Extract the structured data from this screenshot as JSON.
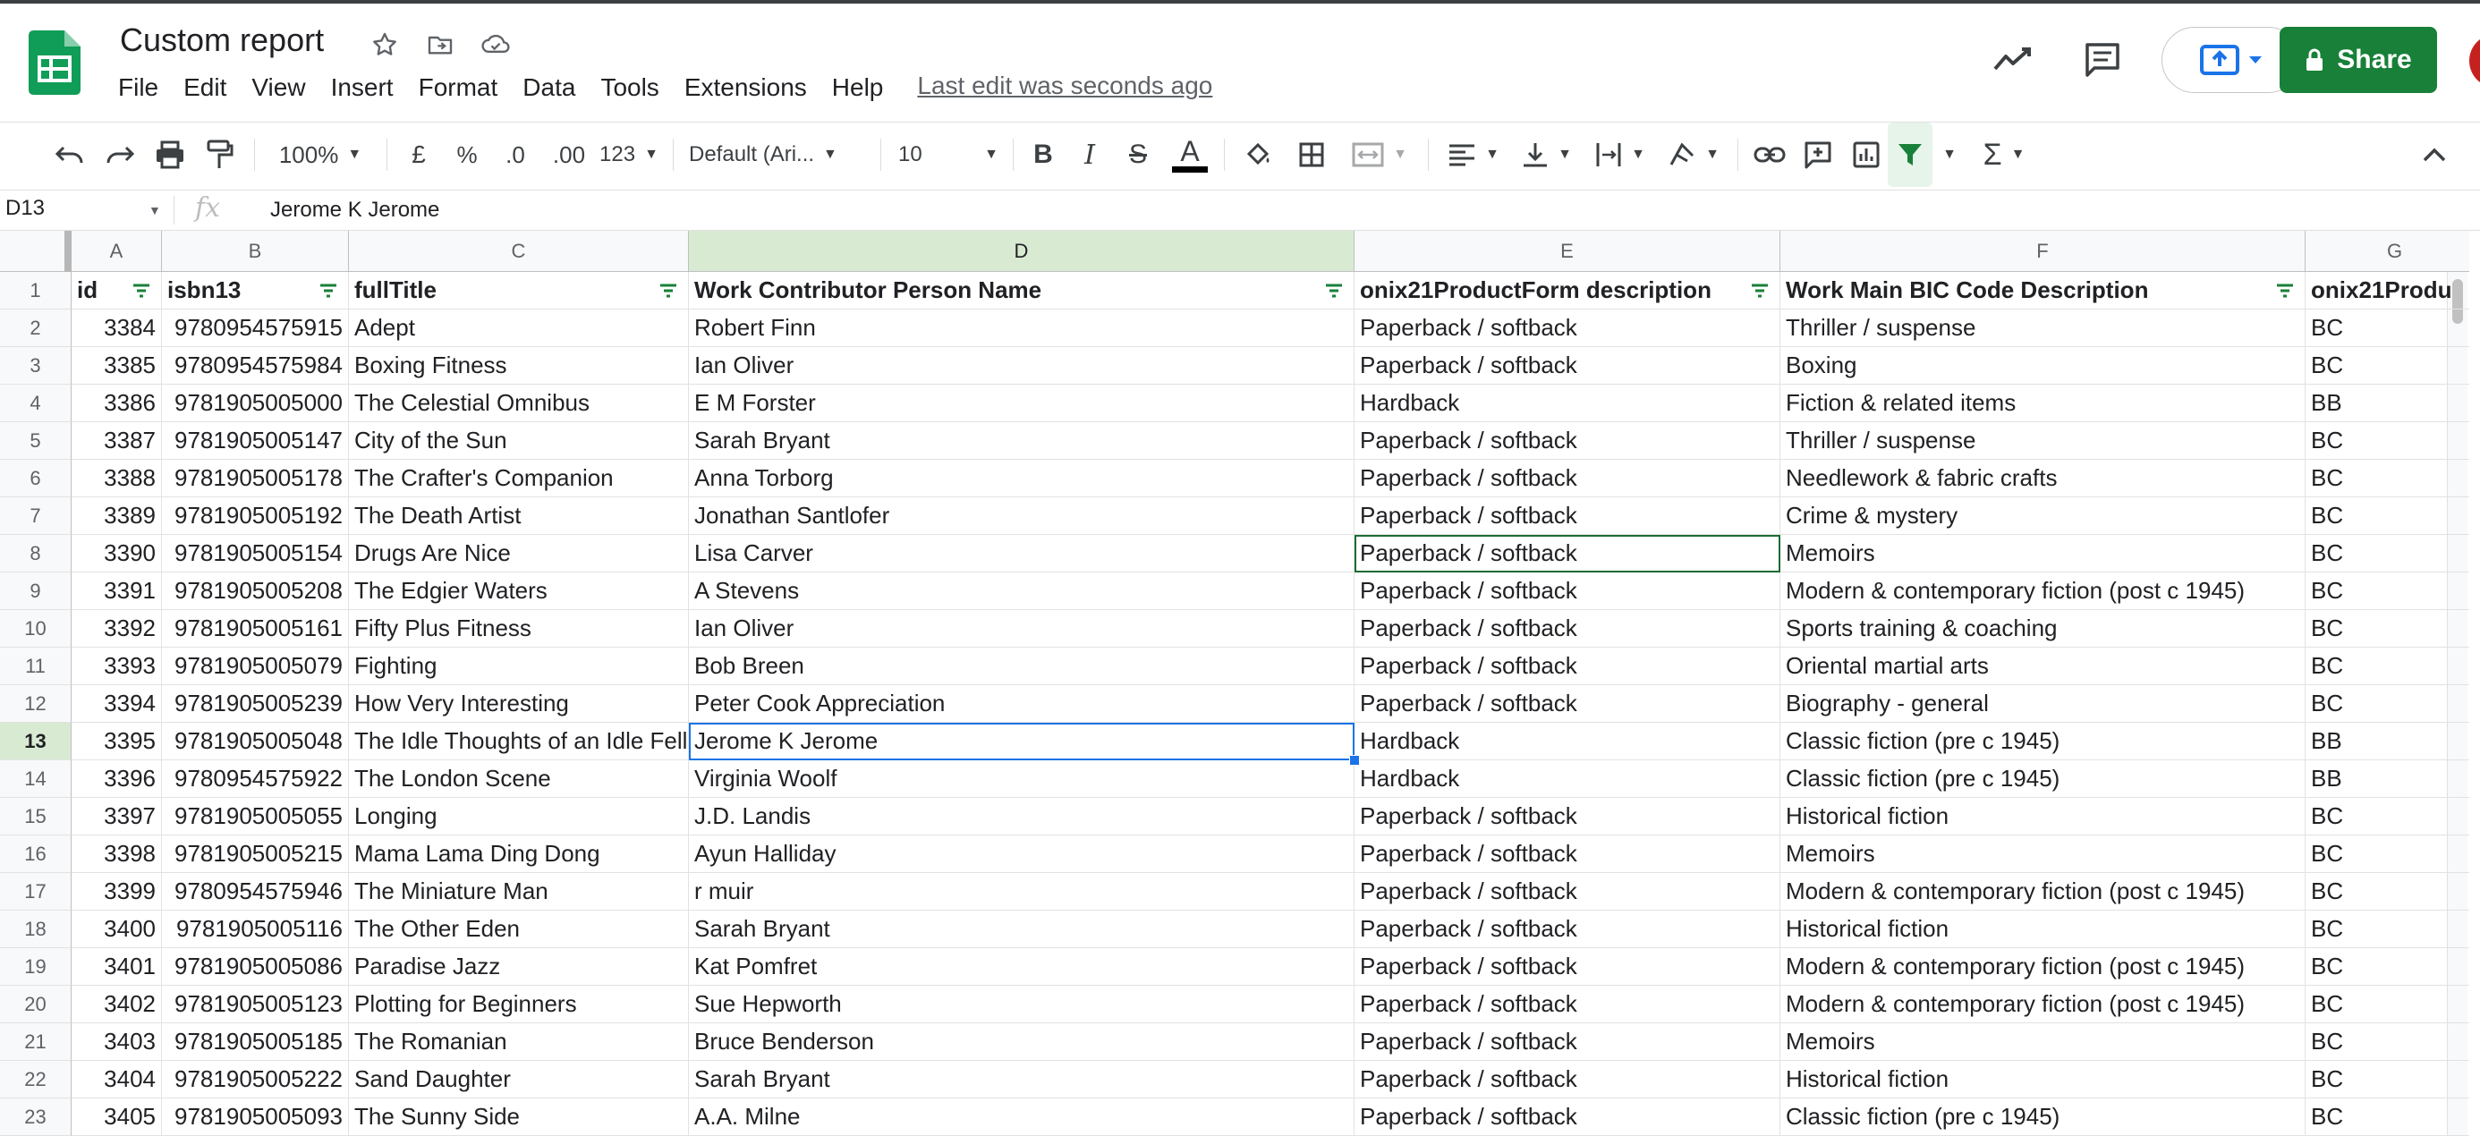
{
  "app": {
    "title": "Custom report",
    "menu": [
      "File",
      "Edit",
      "View",
      "Insert",
      "Format",
      "Data",
      "Tools",
      "Extensions",
      "Help"
    ],
    "last_edit": "Last edit was seconds ago",
    "share_label": "Share",
    "brand_color": "#188038"
  },
  "toolbar": {
    "zoom": "100%",
    "currency": "£",
    "percent": "%",
    "dec_decrease": ".0",
    "dec_increase": ".00",
    "more_formats": "123",
    "font_family": "Default (Ari...",
    "font_size": "10",
    "bold": "B",
    "italic": "I",
    "strike": "S",
    "text_color": "A",
    "sum": "Σ"
  },
  "formula_bar": {
    "cell_ref": "D13",
    "fx": "fx",
    "value": "Jerome K Jerome"
  },
  "grid": {
    "columns": [
      "A",
      "B",
      "C",
      "D",
      "E",
      "F",
      "G"
    ],
    "row_numbers": [
      "1",
      "2",
      "3",
      "4",
      "5",
      "6",
      "7",
      "8",
      "9",
      "10",
      "11",
      "12",
      "13",
      "14",
      "15",
      "16",
      "17",
      "18",
      "19",
      "20",
      "21",
      "22",
      "23"
    ],
    "headers": [
      "id",
      "isbn13",
      "fullTitle",
      "Work Contributor Person Name",
      "onix21ProductForm description",
      "Work Main BIC Code Description",
      "onix21Produ"
    ],
    "rows": [
      [
        "3384",
        "9780954575915",
        "Adept",
        "Robert Finn",
        "Paperback / softback",
        "Thriller / suspense",
        "BC"
      ],
      [
        "3385",
        "9780954575984",
        "Boxing Fitness",
        "Ian Oliver",
        "Paperback / softback",
        "Boxing",
        "BC"
      ],
      [
        "3386",
        "9781905005000",
        "The Celestial Omnibus",
        "E M Forster",
        "Hardback",
        "Fiction & related items",
        "BB"
      ],
      [
        "3387",
        "9781905005147",
        "City of the Sun",
        "Sarah Bryant",
        "Paperback / softback",
        "Thriller / suspense",
        "BC"
      ],
      [
        "3388",
        "9781905005178",
        "The Crafter's Companion",
        "Anna Torborg",
        "Paperback / softback",
        "Needlework & fabric crafts",
        "BC"
      ],
      [
        "3389",
        "9781905005192",
        "The Death Artist",
        "Jonathan Santlofer",
        "Paperback / softback",
        "Crime & mystery",
        "BC"
      ],
      [
        "3390",
        "9781905005154",
        "Drugs Are Nice",
        "Lisa Carver",
        "Paperback / softback",
        "Memoirs",
        "BC"
      ],
      [
        "3391",
        "9781905005208",
        "The Edgier Waters",
        "A Stevens",
        "Paperback / softback",
        "Modern & contemporary fiction (post c 1945)",
        "BC"
      ],
      [
        "3392",
        "9781905005161",
        "Fifty Plus Fitness",
        "Ian Oliver",
        "Paperback / softback",
        "Sports training & coaching",
        "BC"
      ],
      [
        "3393",
        "9781905005079",
        "Fighting",
        "Bob Breen",
        "Paperback / softback",
        "Oriental martial arts",
        "BC"
      ],
      [
        "3394",
        "9781905005239",
        "How Very Interesting",
        "Peter Cook Appreciation",
        "Paperback / softback",
        "Biography - general",
        "BC"
      ],
      [
        "3395",
        "9781905005048",
        "The Idle Thoughts of an Idle Fellow",
        "Jerome K Jerome",
        "Hardback",
        "Classic fiction (pre c 1945)",
        "BB"
      ],
      [
        "3396",
        "9780954575922",
        "The London Scene",
        "Virginia Woolf",
        "Hardback",
        "Classic fiction (pre c 1945)",
        "BB"
      ],
      [
        "3397",
        "9781905005055",
        "Longing",
        "J.D. Landis",
        "Paperback / softback",
        "Historical fiction",
        "BC"
      ],
      [
        "3398",
        "9781905005215",
        "Mama Lama Ding Dong",
        "Ayun Halliday",
        "Paperback / softback",
        "Memoirs",
        "BC"
      ],
      [
        "3399",
        "9780954575946",
        "The Miniature Man",
        "r muir",
        "Paperback / softback",
        "Modern & contemporary fiction (post c 1945)",
        "BC"
      ],
      [
        "3400",
        "9781905005116",
        "The Other Eden",
        "Sarah Bryant",
        "Paperback / softback",
        "Historical fiction",
        "BC"
      ],
      [
        "3401",
        "9781905005086",
        "Paradise Jazz",
        "Kat Pomfret",
        "Paperback / softback",
        "Modern & contemporary fiction (post c 1945)",
        "BC"
      ],
      [
        "3402",
        "9781905005123",
        "Plotting for Beginners",
        "Sue Hepworth",
        "Paperback / softback",
        "Modern & contemporary fiction (post c 1945)",
        "BC"
      ],
      [
        "3403",
        "9781905005185",
        "The Romanian",
        "Bruce Benderson",
        "Paperback / softback",
        "Memoirs",
        "BC"
      ],
      [
        "3404",
        "9781905005222",
        "Sand Daughter",
        "Sarah Bryant",
        "Paperback / softback",
        "Historical fiction",
        "BC"
      ],
      [
        "3405",
        "9781905005093",
        "The Sunny Side",
        "A.A. Milne",
        "Paperback / softback",
        "Classic fiction (pre c 1945)",
        "BC"
      ]
    ]
  }
}
